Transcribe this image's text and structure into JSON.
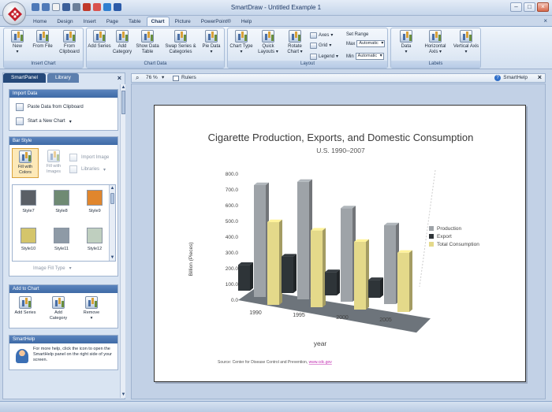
{
  "app": {
    "title": "SmartDraw - Untitled Example 1"
  },
  "tabs": [
    "Home",
    "Design",
    "Insert",
    "Page",
    "Table",
    "Chart",
    "Picture",
    "PowerPoint®",
    "Help"
  ],
  "ribbon": {
    "groups": [
      {
        "label": "Insert Chart",
        "buttons": [
          "New",
          "From File",
          "From Clipboard"
        ]
      },
      {
        "label": "Chart Data",
        "buttons": [
          "Add Series",
          "Add Category",
          "Show Data Table",
          "Swap Series & Categories",
          "Pie Data"
        ]
      },
      {
        "label": "Layout",
        "buttons": [
          "Chart Type",
          "Quick Layouts",
          "Rotate Chart"
        ]
      },
      {
        "label": "Labels",
        "buttons": [
          "Data",
          "Horizontal Axis",
          "Vertical Axis"
        ]
      }
    ],
    "layout_options": {
      "axes": "Axes",
      "grid": "Grid",
      "legend": "Legend",
      "set_range": "Set Range",
      "max": "Max",
      "min": "Min",
      "max_value": "Automatic",
      "min_value": "Automatic"
    }
  },
  "panel": {
    "tabs": [
      "SmartPanel",
      "Library"
    ],
    "import": {
      "title": "Import Data",
      "paste": "Paste Data from Clipboard",
      "start": "Start a New Chart"
    },
    "bar_style": {
      "title": "Bar Style",
      "fill_colors": "Fill with Colors",
      "fill_images": "Fill with Images",
      "import_image": "Import Image",
      "libraries": "Libraries",
      "image_fill_type": "Image Fill Type",
      "styles": [
        {
          "name": "Style7",
          "color": "#5a5f66"
        },
        {
          "name": "Style8",
          "color": "#6f8a73"
        },
        {
          "name": "Style9",
          "color": "#e0862d"
        },
        {
          "name": "Style10",
          "color": "#d4c56b"
        },
        {
          "name": "Style11",
          "color": "#8e9aa6"
        },
        {
          "name": "Style12",
          "color": "#bfcfbf"
        }
      ]
    },
    "add_to_chart": {
      "title": "Add to Chart",
      "add_series": "Add Series",
      "add_category": "Add Category",
      "remove": "Remove"
    },
    "smarthelp": {
      "title": "SmartHelp",
      "text": "For more help, click the icon to open the SmartHelp panel on the right side of your screen."
    }
  },
  "toolbar": {
    "zoom": "76 %",
    "rulers": "Rulers",
    "smarthelp": "SmartHelp"
  },
  "chart_data": {
    "type": "bar",
    "title": "Cigarette Production, Exports, and Domestic Consumption",
    "subtitle": "U.S. 1990–2007",
    "xlabel": "year",
    "ylabel": "Billion (Pieces)",
    "categories": [
      "1990",
      "1995",
      "2000",
      "2005"
    ],
    "series": [
      {
        "name": "Production",
        "color": "#9ea3a8",
        "values": [
          710,
          746,
          593,
          500
        ]
      },
      {
        "name": "Export",
        "color": "#2e3438",
        "values": [
          164,
          232,
          148,
          113
        ]
      },
      {
        "name": "Total Consumption",
        "color": "#e4d98a",
        "values": [
          525,
          487,
          430,
          376
        ]
      }
    ],
    "yticks": [
      "0.0",
      "100.0",
      "200.0",
      "300.0",
      "400.0",
      "500.0",
      "600.0",
      "700.0",
      "800.0"
    ],
    "ylim": [
      0,
      800
    ],
    "legend": "right",
    "source_prefix": "Source: Center for Disease Control and Prevention,",
    "source_link": "www.cdc.gov"
  }
}
